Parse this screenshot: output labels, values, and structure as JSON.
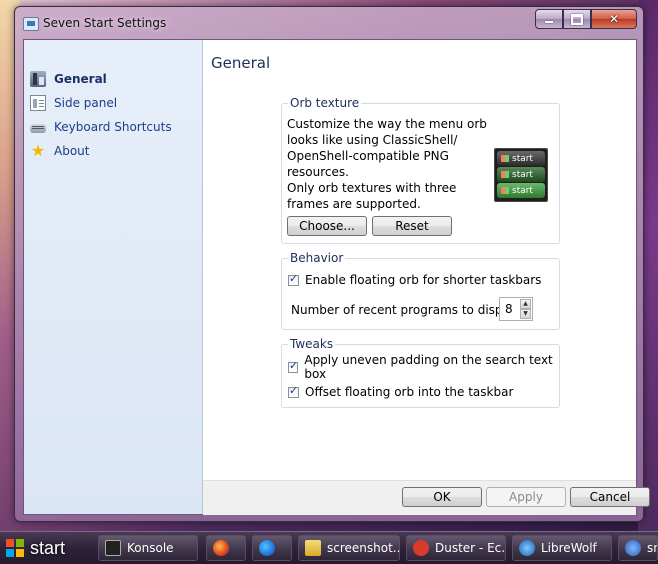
{
  "window": {
    "title": "Seven Start Settings"
  },
  "sidebar": {
    "items": [
      {
        "label": "General",
        "icon": "general-icon",
        "active": true
      },
      {
        "label": "Side panel",
        "icon": "side-panel-icon"
      },
      {
        "label": "Keyboard Shortcuts",
        "icon": "keyboard-icon"
      },
      {
        "label": "About",
        "icon": "star-icon"
      }
    ]
  },
  "main": {
    "heading": "General",
    "orb_texture": {
      "title": "Orb texture",
      "description": "Customize the way the menu orb looks like using ClassicShell/ OpenShell-compatible PNG resources.\nOnly orb textures with three frames are supported.",
      "preview_label": "start",
      "choose_label": "Choose...",
      "reset_label": "Reset"
    },
    "behavior": {
      "title": "Behavior",
      "floating_orb_label": "Enable floating orb for shorter taskbars",
      "floating_orb_checked": true,
      "recent_label": "Number of recent programs to display:",
      "recent_value": "8"
    },
    "tweaks": {
      "title": "Tweaks",
      "padding_label": "Apply uneven padding on the search text box",
      "padding_checked": true,
      "offset_label": "Offset floating orb into the taskbar",
      "offset_checked": true
    }
  },
  "footer": {
    "ok_label": "OK",
    "apply_label": "Apply",
    "cancel_label": "Cancel"
  },
  "taskbar": {
    "start_label": "start",
    "tasks": [
      {
        "label": "Konsole",
        "icon": "konsole-icon"
      },
      {
        "label": "",
        "icon": "firefox-icon"
      },
      {
        "label": "",
        "icon": "firefox-blue-icon"
      },
      {
        "label": "screenshot...",
        "icon": "folder-icon"
      },
      {
        "label": "Duster - Ec...",
        "icon": "duster-icon"
      },
      {
        "label": "LibreWolf",
        "icon": "librewolf-icon"
      },
      {
        "label": "sn",
        "icon": "app-icon"
      }
    ]
  }
}
